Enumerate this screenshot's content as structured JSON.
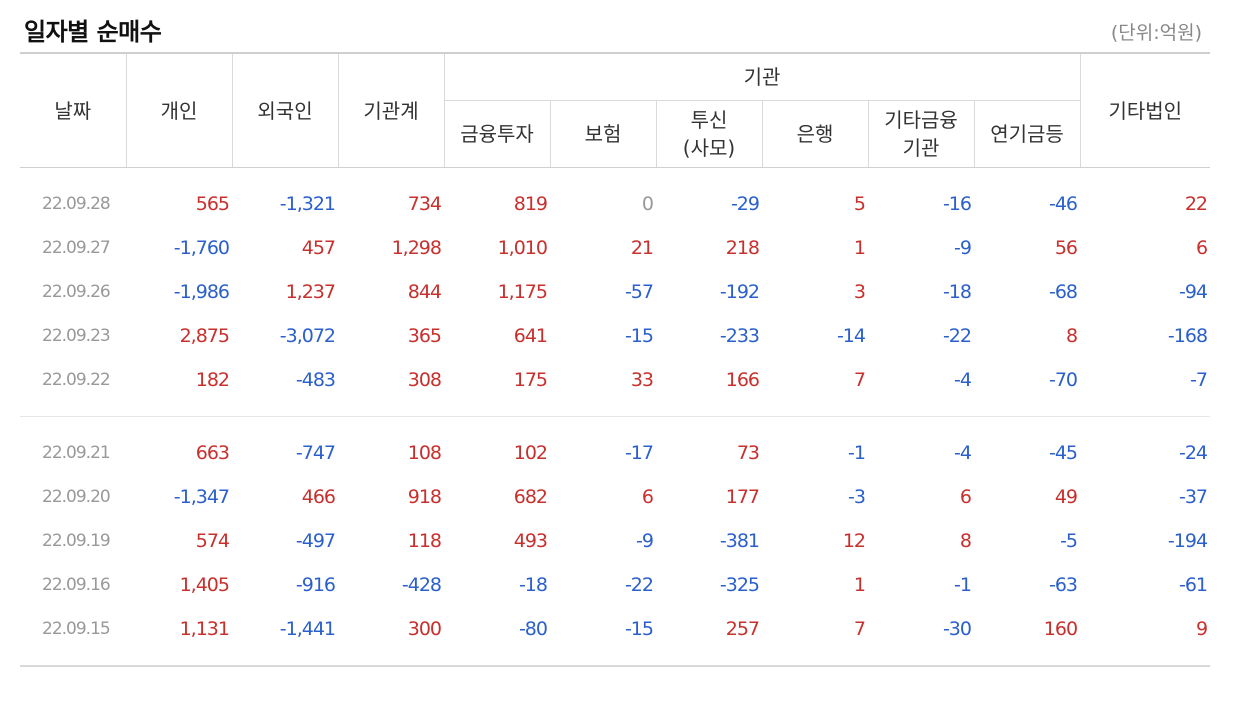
{
  "title": "일자별 순매수",
  "unit": "(단위:억원)",
  "headers": {
    "date": "날짜",
    "individual": "개인",
    "foreign": "외국인",
    "institution_total": "기관계",
    "institution_group": "기관",
    "financial_investment": "금융투자",
    "insurance": "보험",
    "trust_line1": "투신",
    "trust_line2": "(사모)",
    "bank": "은행",
    "other_finance_line1": "기타금융",
    "other_finance_line2": "기관",
    "pension": "연기금등",
    "other_corp": "기타법인"
  },
  "groups": [
    {
      "rows": [
        {
          "date": "22.09.28",
          "values": [
            "565",
            "-1,321",
            "734",
            "819",
            "0",
            "-29",
            "5",
            "-16",
            "-46",
            "22"
          ]
        },
        {
          "date": "22.09.27",
          "values": [
            "-1,760",
            "457",
            "1,298",
            "1,010",
            "21",
            "218",
            "1",
            "-9",
            "56",
            "6"
          ]
        },
        {
          "date": "22.09.26",
          "values": [
            "-1,986",
            "1,237",
            "844",
            "1,175",
            "-57",
            "-192",
            "3",
            "-18",
            "-68",
            "-94"
          ]
        },
        {
          "date": "22.09.23",
          "values": [
            "2,875",
            "-3,072",
            "365",
            "641",
            "-15",
            "-233",
            "-14",
            "-22",
            "8",
            "-168"
          ]
        },
        {
          "date": "22.09.22",
          "values": [
            "182",
            "-483",
            "308",
            "175",
            "33",
            "166",
            "7",
            "-4",
            "-70",
            "-7"
          ]
        }
      ]
    },
    {
      "rows": [
        {
          "date": "22.09.21",
          "values": [
            "663",
            "-747",
            "108",
            "102",
            "-17",
            "73",
            "-1",
            "-4",
            "-45",
            "-24"
          ]
        },
        {
          "date": "22.09.20",
          "values": [
            "-1,347",
            "466",
            "918",
            "682",
            "6",
            "177",
            "-3",
            "6",
            "49",
            "-37"
          ]
        },
        {
          "date": "22.09.19",
          "values": [
            "574",
            "-497",
            "118",
            "493",
            "-9",
            "-381",
            "12",
            "8",
            "-5",
            "-194"
          ]
        },
        {
          "date": "22.09.16",
          "values": [
            "1,405",
            "-916",
            "-428",
            "-18",
            "-22",
            "-325",
            "1",
            "-1",
            "-63",
            "-61"
          ]
        },
        {
          "date": "22.09.15",
          "values": [
            "1,131",
            "-1,441",
            "300",
            "-80",
            "-15",
            "257",
            "7",
            "-30",
            "160",
            "9"
          ]
        }
      ]
    }
  ],
  "colors": {
    "positive": "#c7302d",
    "negative": "#2a5fcc",
    "zero": "#999999"
  }
}
